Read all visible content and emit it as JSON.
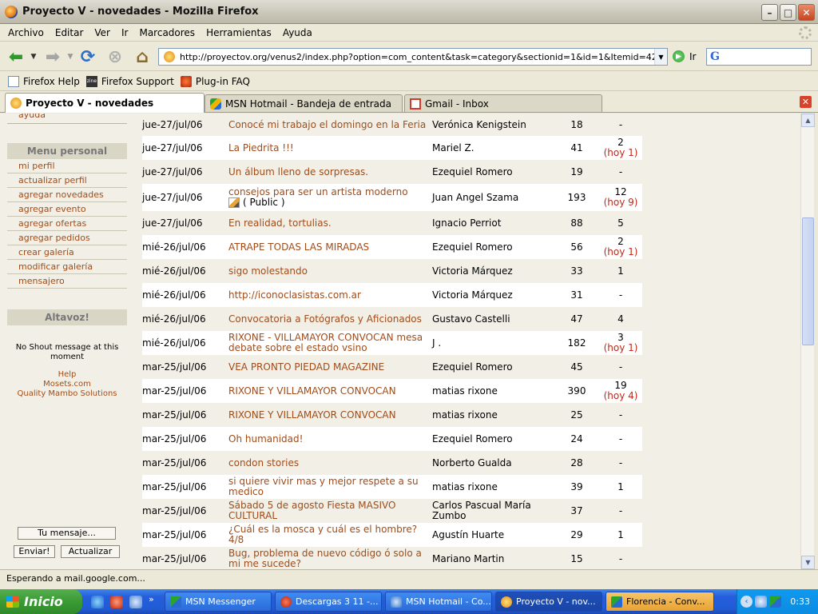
{
  "window": {
    "title": "Proyecto V - novedades - Mozilla Firefox"
  },
  "menu": [
    "Archivo",
    "Editar",
    "Ver",
    "Ir",
    "Marcadores",
    "Herramientas",
    "Ayuda"
  ],
  "nav": {
    "url": "http://proyectov.org/venus2/index.php?option=com_content&task=category&sectionid=1&id=1&Itemid=42",
    "go_label": "Ir",
    "search_icon": "G"
  },
  "bookmarks": [
    "Firefox Help",
    "Firefox Support",
    "Plug-in FAQ"
  ],
  "bookmark_zine_text": "zine",
  "tabs": [
    "Proyecto V - novedades",
    "MSN Hotmail - Bandeja de entrada",
    "Gmail - Inbox"
  ],
  "sidebar": {
    "cut_item": "ayuda",
    "menu_title": "Menu personal",
    "menu_items": [
      "mi perfil",
      "actualizar perfil",
      "agregar novedades",
      "agregar evento",
      "agregar ofertas",
      "agregar pedidos",
      "crear galería",
      "modificar galería",
      "mensajero"
    ],
    "shout_title": "Altavoz!",
    "shout_message": "No Shout message at this moment",
    "shout_help": "Help",
    "shout_credit1": "Mosets.com",
    "shout_credit2": "Quality Mambo Solutions",
    "your_message_btn": "Tu mensaje...",
    "send_btn": "Enviar!",
    "update_btn": "Actualizar"
  },
  "rows": [
    {
      "date": "jue-27/jul/06",
      "title": "Conocé mi trabajo el domingo en la Feria",
      "author": "Verónica Kenigstein",
      "hits": "18",
      "replies": "-",
      "today": ""
    },
    {
      "date": "jue-27/jul/06",
      "title": "La Piedrita !!!",
      "author": "Mariel Z.",
      "hits": "41",
      "replies": "2",
      "today": "(hoy 1)"
    },
    {
      "date": "jue-27/jul/06",
      "title": "Un álbum lleno de sorpresas.",
      "author": "Ezequiel Romero",
      "hits": "19",
      "replies": "-",
      "today": ""
    },
    {
      "date": "jue-27/jul/06",
      "title": "consejos para ser un artista moderno",
      "public": "( Public )",
      "author": "Juan Angel Szama",
      "hits": "193",
      "replies": "12",
      "today": "(hoy 9)"
    },
    {
      "date": "jue-27/jul/06",
      "title": "En realidad, tortulias.",
      "author": "Ignacio Perriot",
      "hits": "88",
      "replies": "5",
      "today": ""
    },
    {
      "date": "mié-26/jul/06",
      "title": "ATRAPE TODAS LAS MIRADAS",
      "author": "Ezequiel Romero",
      "hits": "56",
      "replies": "2",
      "today": "(hoy 1)"
    },
    {
      "date": "mié-26/jul/06",
      "title": "sigo molestando",
      "author": "Victoria Márquez",
      "hits": "33",
      "replies": "1",
      "today": ""
    },
    {
      "date": "mié-26/jul/06",
      "title": "http://iconoclasistas.com.ar",
      "author": "Victoria Márquez",
      "hits": "31",
      "replies": "-",
      "today": ""
    },
    {
      "date": "mié-26/jul/06",
      "title": "Convocatoria a Fotógrafos y Aficionados",
      "author": "Gustavo Castelli",
      "hits": "47",
      "replies": "4",
      "today": ""
    },
    {
      "date": "mié-26/jul/06",
      "title": "RIXONE - VILLAMAYOR CONVOCAN mesa debate sobre el estado vsino",
      "author": "J .",
      "hits": "182",
      "replies": "3",
      "today": "(hoy 1)"
    },
    {
      "date": "mar-25/jul/06",
      "title": "VEA PRONTO PIEDAD MAGAZINE",
      "author": "Ezequiel Romero",
      "hits": "45",
      "replies": "-",
      "today": ""
    },
    {
      "date": "mar-25/jul/06",
      "title": "RIXONE Y VILLAMAYOR CONVOCAN",
      "author": "matias rixone",
      "hits": "390",
      "replies": "19",
      "today": "(hoy 4)"
    },
    {
      "date": "mar-25/jul/06",
      "title": "RIXONE Y VILLAMAYOR CONVOCAN",
      "author": "matias rixone",
      "hits": "25",
      "replies": "-",
      "today": ""
    },
    {
      "date": "mar-25/jul/06",
      "title": "Oh humanidad!",
      "author": "Ezequiel Romero",
      "hits": "24",
      "replies": "-",
      "today": ""
    },
    {
      "date": "mar-25/jul/06",
      "title": "condon stories",
      "author": "Norberto Gualda",
      "hits": "28",
      "replies": "-",
      "today": ""
    },
    {
      "date": "mar-25/jul/06",
      "title": "si quiere vivir mas y mejor respete a su medico",
      "author": "matias rixone",
      "hits": "39",
      "replies": "1",
      "today": ""
    },
    {
      "date": "mar-25/jul/06",
      "title": "Sábado 5 de agosto Fiesta MASIVO CULTURAL",
      "author": "Carlos Pascual María Zumbo",
      "hits": "37",
      "replies": "-",
      "today": ""
    },
    {
      "date": "mar-25/jul/06",
      "title": "¿Cuál es la mosca y cuál es el hombre? 4/8",
      "author": "Agustín Huarte",
      "hits": "29",
      "replies": "1",
      "today": ""
    },
    {
      "date": "mar-25/jul/06",
      "title": "Bug, problema de nuevo código ó solo a mi me sucede?",
      "author": "Mariano Martin",
      "hits": "15",
      "replies": "-",
      "today": ""
    }
  ],
  "status": "Esperando a mail.google.com...",
  "taskbar": {
    "start": "Inicio",
    "items": [
      "MSN Messenger",
      "Descargas 3 11 -...",
      "MSN Hotmail - Co...",
      "Proyecto V - nov...",
      "Florencia - Conv..."
    ],
    "clock": "0:33"
  }
}
